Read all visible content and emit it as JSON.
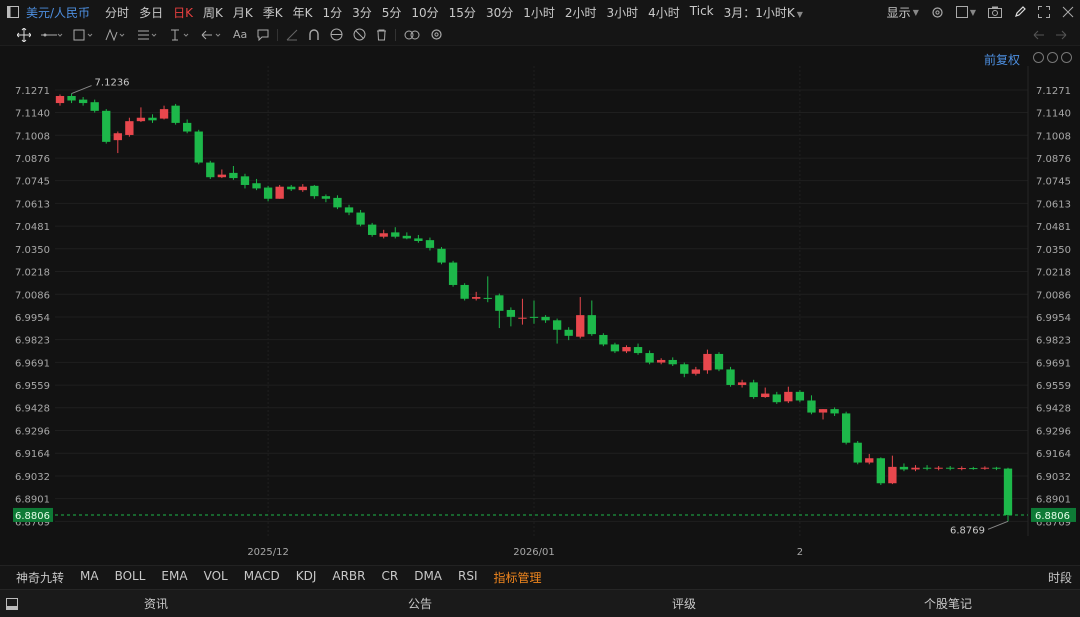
{
  "topbar": {
    "symbol": "美元/人民币",
    "periods": [
      {
        "label": "分时",
        "active": false
      },
      {
        "label": "多日",
        "active": false
      },
      {
        "label": "日K",
        "active": true
      },
      {
        "label": "周K",
        "active": false
      },
      {
        "label": "月K",
        "active": false
      },
      {
        "label": "季K",
        "active": false
      },
      {
        "label": "年K",
        "active": false
      },
      {
        "label": "1分",
        "active": false
      },
      {
        "label": "3分",
        "active": false
      },
      {
        "label": "5分",
        "active": false
      },
      {
        "label": "10分",
        "active": false
      },
      {
        "label": "15分",
        "active": false
      },
      {
        "label": "30分",
        "active": false
      },
      {
        "label": "1小时",
        "active": false
      },
      {
        "label": "2小时",
        "active": false
      },
      {
        "label": "3小时",
        "active": false
      },
      {
        "label": "4小时",
        "active": false
      },
      {
        "label": "Tick",
        "active": false
      }
    ],
    "period_select": "3月：1小时K",
    "display_label": "显示"
  },
  "chart_header": {
    "adjust_label": "前复权"
  },
  "colors": {
    "up": "#e8474d",
    "down": "#1db84a",
    "accent_blue": "#4d8fe0",
    "highlight_orange": "#f0861e",
    "active_red": "#e94040"
  },
  "indicators": {
    "items": [
      "神奇九转",
      "MA",
      "BOLL",
      "EMA",
      "VOL",
      "MACD",
      "KDJ",
      "ARBR",
      "CR",
      "DMA",
      "RSI"
    ],
    "manage_label": "指标管理",
    "timeframe_label": "时段"
  },
  "bottom_tabs": [
    "资讯",
    "公告",
    "评级",
    "个股笔记"
  ],
  "chart_data": {
    "type": "candlestick",
    "y_ticks": [
      "7.1271",
      "7.1140",
      "7.1008",
      "7.0876",
      "7.0745",
      "7.0613",
      "7.0481",
      "7.0350",
      "7.0218",
      "7.0086",
      "6.9954",
      "6.9823",
      "6.9691",
      "6.9559",
      "6.9428",
      "6.9296",
      "6.9164",
      "6.9032",
      "6.8901",
      "6.8769"
    ],
    "ylim": [
      6.8742,
      7.141
    ],
    "x_ticks": [
      {
        "label": "2025/12",
        "index": 18
      },
      {
        "label": "2026/01",
        "index": 41
      },
      {
        "label": "2",
        "index": 64
      }
    ],
    "last_price_label": "6.8806",
    "last_price": 6.8806,
    "max_label": "7.1236",
    "min_label": "6.8769",
    "max_index": 1,
    "min_index": 82,
    "candles": [
      [
        7.1195,
        7.1236,
        7.1245,
        7.118
      ],
      [
        7.1236,
        7.121,
        7.125,
        7.1195
      ],
      [
        7.1215,
        7.1195,
        7.123,
        7.118
      ],
      [
        7.12,
        7.115,
        7.1215,
        7.114
      ],
      [
        7.115,
        7.097,
        7.116,
        7.096
      ],
      [
        7.098,
        7.102,
        7.103,
        7.0905
      ],
      [
        7.101,
        7.109,
        7.111,
        7.1
      ],
      [
        7.109,
        7.111,
        7.117,
        7.1085
      ],
      [
        7.111,
        7.1095,
        7.113,
        7.108
      ],
      [
        7.1105,
        7.116,
        7.118,
        7.11
      ],
      [
        7.118,
        7.108,
        7.119,
        7.107
      ],
      [
        7.108,
        7.103,
        7.11,
        7.102
      ],
      [
        7.103,
        7.085,
        7.104,
        7.084
      ],
      [
        7.085,
        7.0765,
        7.086,
        7.0755
      ],
      [
        7.0765,
        7.078,
        7.081,
        7.076
      ],
      [
        7.079,
        7.076,
        7.083,
        7.075
      ],
      [
        7.077,
        7.072,
        7.0785,
        7.07
      ],
      [
        7.073,
        7.07,
        7.0755,
        7.069
      ],
      [
        7.0705,
        7.064,
        7.0715,
        7.0625
      ],
      [
        7.064,
        7.071,
        7.072,
        7.064
      ],
      [
        7.071,
        7.0695,
        7.072,
        7.0685
      ],
      [
        7.069,
        7.071,
        7.0725,
        7.068
      ],
      [
        7.0715,
        7.0655,
        7.072,
        7.064
      ],
      [
        7.0655,
        7.064,
        7.0665,
        7.062
      ],
      [
        7.0645,
        7.059,
        7.066,
        7.058
      ],
      [
        7.059,
        7.056,
        7.0605,
        7.0545
      ],
      [
        7.056,
        7.049,
        7.0575,
        7.048
      ],
      [
        7.049,
        7.043,
        7.05,
        7.042
      ],
      [
        7.042,
        7.044,
        7.046,
        7.041
      ],
      [
        7.0445,
        7.042,
        7.0475,
        7.041
      ],
      [
        7.0425,
        7.041,
        7.0445,
        7.0405
      ],
      [
        7.041,
        7.0395,
        7.043,
        7.0385
      ],
      [
        7.04,
        7.0355,
        7.0415,
        7.034
      ],
      [
        7.035,
        7.027,
        7.036,
        7.026
      ],
      [
        7.027,
        7.014,
        7.028,
        7.013
      ],
      [
        7.014,
        7.006,
        7.015,
        7.005
      ],
      [
        7.006,
        7.007,
        7.01,
        7.005
      ],
      [
        7.0065,
        7.006,
        7.019,
        7.004
      ],
      [
        7.008,
        6.999,
        7.009,
        6.989
      ],
      [
        6.9995,
        6.9955,
        7.001,
        6.99
      ],
      [
        6.995,
        6.995,
        7.006,
        6.991
      ],
      [
        6.9955,
        6.995,
        7.005,
        6.9915
      ],
      [
        6.9955,
        6.9935,
        6.9965,
        6.992
      ],
      [
        6.9935,
        6.988,
        6.9945,
        6.98
      ],
      [
        6.988,
        6.9845,
        6.9895,
        6.982
      ],
      [
        6.984,
        6.9965,
        7.007,
        6.983
      ],
      [
        6.9965,
        6.9855,
        7.005,
        6.9845
      ],
      [
        6.985,
        6.9795,
        6.986,
        6.9785
      ],
      [
        6.9795,
        6.9755,
        6.9805,
        6.9745
      ],
      [
        6.9755,
        6.978,
        6.979,
        6.9745
      ],
      [
        6.978,
        6.9745,
        6.98,
        6.9735
      ],
      [
        6.9745,
        6.969,
        6.976,
        6.968
      ],
      [
        6.969,
        6.9705,
        6.9715,
        6.968
      ],
      [
        6.9705,
        6.968,
        6.972,
        6.967
      ],
      [
        6.968,
        6.9625,
        6.969,
        6.9605
      ],
      [
        6.9625,
        6.965,
        6.9665,
        6.9615
      ],
      [
        6.9645,
        6.974,
        6.9765,
        6.9625
      ],
      [
        6.974,
        6.965,
        6.975,
        6.964
      ],
      [
        6.965,
        6.956,
        6.9665,
        6.955
      ],
      [
        6.956,
        6.9575,
        6.959,
        6.9545
      ],
      [
        6.9575,
        6.949,
        6.959,
        6.948
      ],
      [
        6.949,
        6.951,
        6.9545,
        6.9485
      ],
      [
        6.9505,
        6.946,
        6.952,
        6.945
      ],
      [
        6.9465,
        6.952,
        6.955,
        6.9455
      ],
      [
        6.952,
        6.947,
        6.953,
        6.946
      ],
      [
        6.947,
        6.94,
        6.95,
        6.939
      ],
      [
        6.94,
        6.942,
        6.942,
        6.936
      ],
      [
        6.942,
        6.9395,
        6.943,
        6.938
      ],
      [
        6.9395,
        6.9225,
        6.9405,
        6.9215
      ],
      [
        6.9225,
        6.911,
        6.9235,
        6.91
      ],
      [
        6.911,
        6.9135,
        6.916,
        6.91
      ],
      [
        6.9135,
        6.899,
        6.914,
        6.898
      ],
      [
        6.899,
        6.9085,
        6.915,
        6.8985
      ],
      [
        6.9085,
        6.907,
        6.9105,
        6.906
      ],
      [
        6.907,
        6.908,
        6.9095,
        6.906
      ],
      [
        6.908,
        6.9075,
        6.9095,
        6.9065
      ],
      [
        6.9075,
        6.908,
        6.909,
        6.9065
      ],
      [
        6.908,
        6.9075,
        6.909,
        6.9065
      ],
      [
        6.9075,
        6.9078,
        6.9088,
        6.9065
      ],
      [
        6.9078,
        6.9076,
        6.9085,
        6.9068
      ],
      [
        6.9076,
        6.908,
        6.9088,
        6.9068
      ],
      [
        6.908,
        6.9075,
        6.9085,
        6.9066
      ],
      [
        6.9075,
        6.8806,
        6.908,
        6.8769
      ]
    ]
  }
}
